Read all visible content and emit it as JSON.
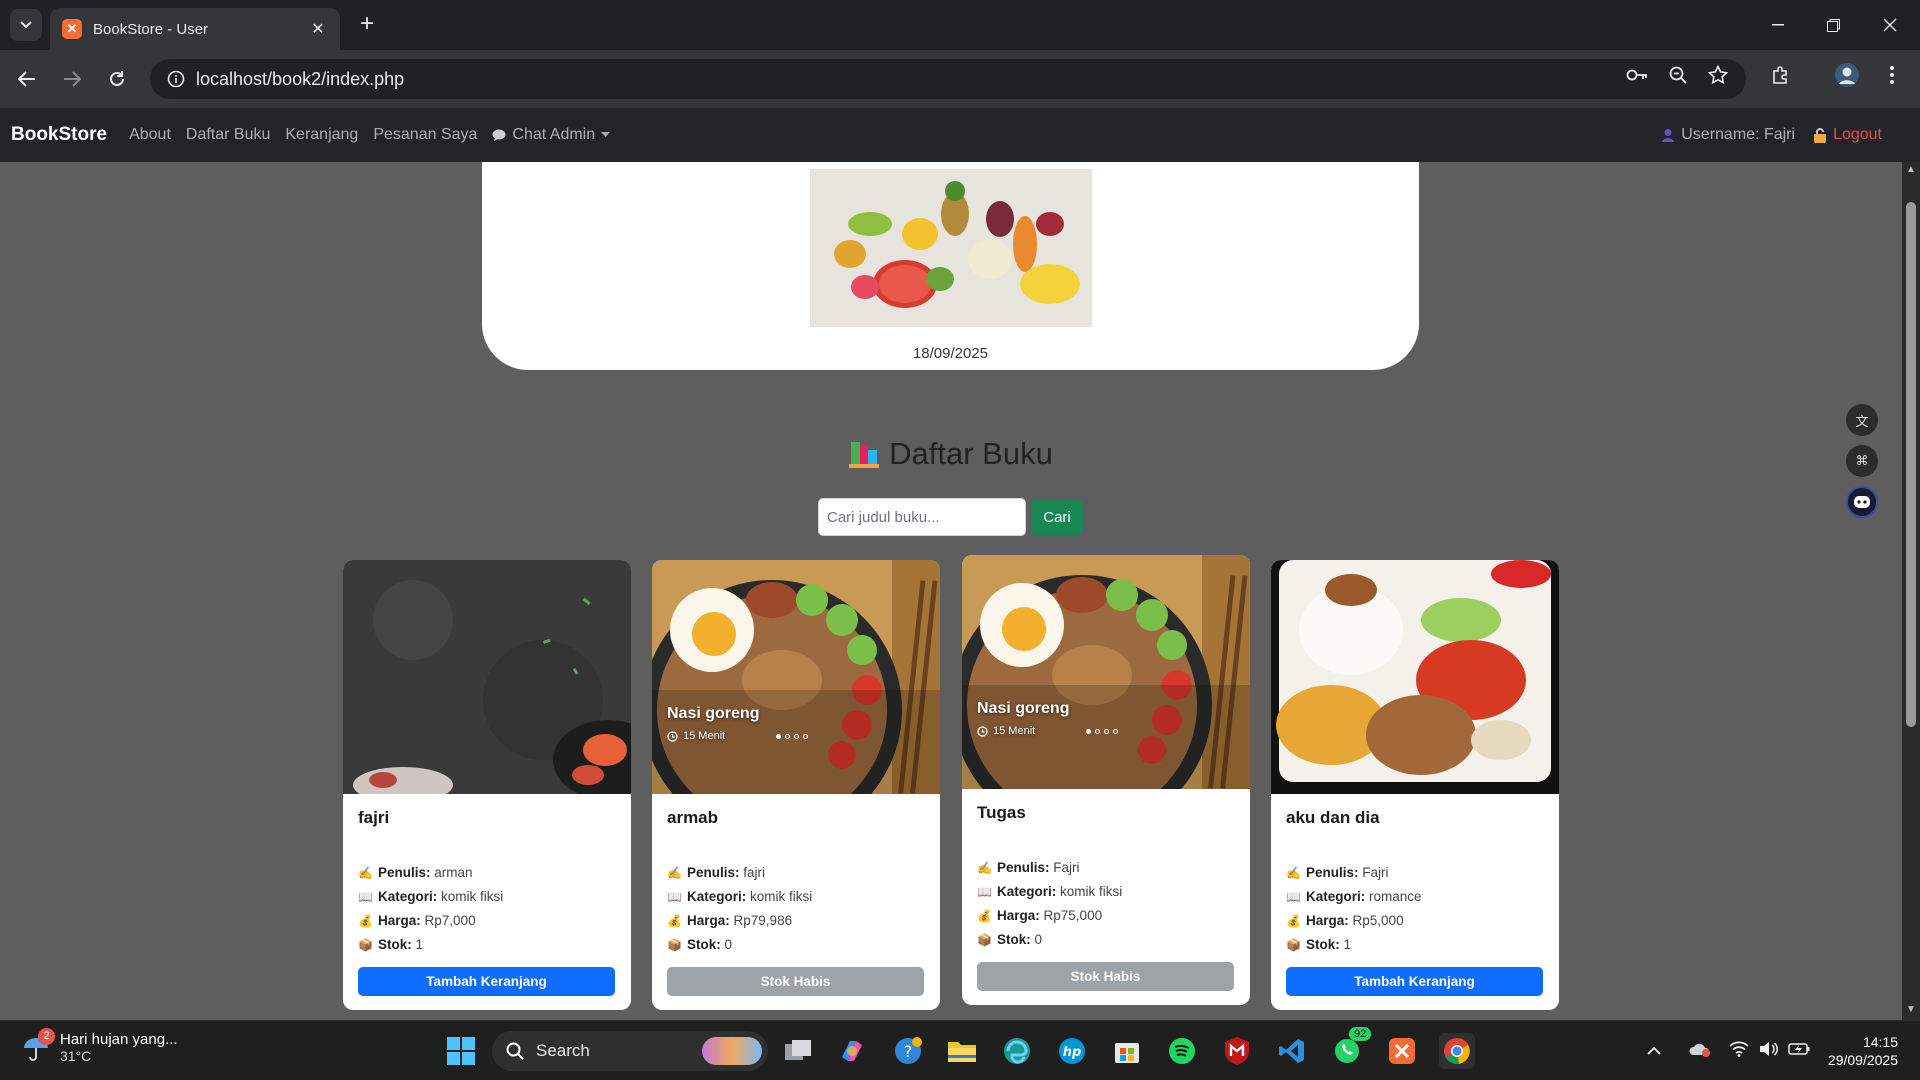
{
  "browser": {
    "tab_title": "BookStore - User",
    "url": "localhost/book2/index.php"
  },
  "navbar": {
    "brand": "BookStore",
    "links": [
      "About",
      "Daftar Buku",
      "Keranjang",
      "Pesanan Saya"
    ],
    "chat_admin": "Chat Admin",
    "username": "Username: Fajri",
    "logout": "Logout"
  },
  "top_card": {
    "date": "18/09/2025"
  },
  "section": {
    "title": "Daftar Buku",
    "search_placeholder": "Cari judul buku...",
    "search_button": "Cari"
  },
  "labels": {
    "penulis": "Penulis:",
    "kategori": "Kategori:",
    "harga": "Harga:",
    "stok": "Stok:"
  },
  "books": [
    {
      "title": "fajri",
      "penulis": "arman",
      "kategori": "komik fiksi",
      "harga": "Rp7,000",
      "stok": "1",
      "button": "Tambah Keranjang",
      "available": true
    },
    {
      "title": "armab",
      "penulis": "fajri",
      "kategori": "komik fiksi",
      "harga": "Rp79,986",
      "stok": "0",
      "button": "Stok Habis",
      "available": false,
      "overlay_title": "Nasi goreng",
      "overlay_time": "15 Menit"
    },
    {
      "title": "Tugas",
      "penulis": "Fajri",
      "kategori": "komik fiksi",
      "harga": "Rp75,000",
      "stok": "0",
      "button": "Stok Habis",
      "available": false,
      "overlay_title": "Nasi goreng",
      "overlay_time": "15 Menit"
    },
    {
      "title": "aku dan dia",
      "penulis": "Fajri",
      "kategori": "romance",
      "harga": "Rp5,000",
      "stok": "1",
      "button": "Tambah Keranjang",
      "available": true
    }
  ],
  "taskbar": {
    "weather_text": "Hari hujan yang...",
    "temperature": "31°C",
    "weather_badge": "2",
    "search_label": "Search",
    "whatsapp_badge": "92",
    "time": "14:15",
    "date": "29/09/2025"
  },
  "colors": {
    "primary_button": "#0d6efd",
    "disabled_button": "#9ea3a8",
    "search_button": "#198754",
    "navbar_bg": "#212529",
    "logout": "#ea4a4a"
  }
}
